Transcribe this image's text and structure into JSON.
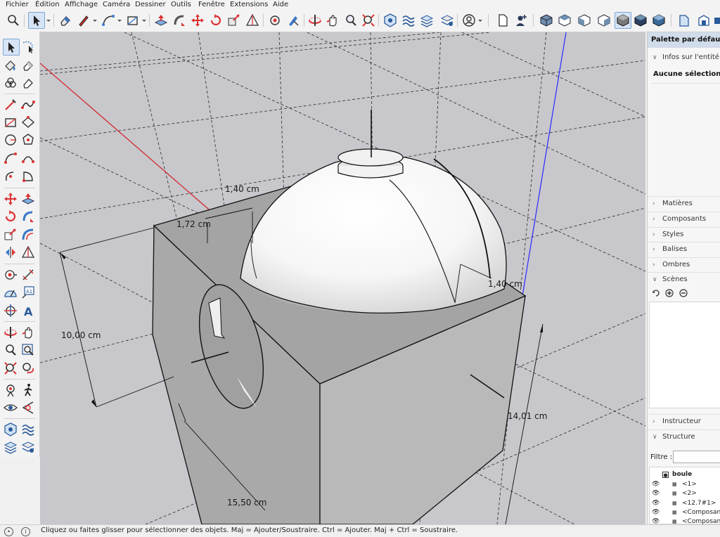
{
  "menu": [
    "Fichier",
    "Édition",
    "Affichage",
    "Caméra",
    "Dessiner",
    "Outils",
    "Fenêtre",
    "Extensions",
    "Aide"
  ],
  "toolbar_icons": [
    "search-icon",
    "select-arrow-icon",
    "eraser-icon",
    "pencil-icon",
    "arc-icon",
    "rectangle-icon",
    "push-pull-icon",
    "follow-me-icon",
    "move-icon",
    "rotate-icon",
    "scale-icon",
    "tape-measure-icon",
    "paint-bucket-icon",
    "orbit-icon",
    "pan-icon",
    "zoom-icon",
    "zoom-extents-icon",
    "solid-tools-icon",
    "sandbox-icon",
    "layers-icon",
    "account-icon",
    "document-icon",
    "user-add-icon",
    "iso-view-icon",
    "top-view-icon",
    "front-view-icon",
    "right-view-icon",
    "back-view-icon",
    "left-view-icon",
    "xray-style-icon",
    "wireframe-style-icon",
    "shaded-style-icon",
    "textured-style-icon"
  ],
  "viewport": {
    "dimensions": [
      "1,40 cm",
      "1,72 cm",
      "10,00 cm",
      "1,40 cm",
      "14,01 cm",
      "15,50 cm"
    ],
    "colors": {
      "background": "#c7c7cc",
      "red_axis": "#d32020",
      "blue_axis": "#2a2aff"
    }
  },
  "tray": {
    "title": "Palette par défaut",
    "entity_info": {
      "header": "Infos sur l'entité",
      "value": "Aucune sélection"
    },
    "sections": [
      "Matières",
      "Composants",
      "Styles",
      "Balises",
      "Ombres"
    ],
    "scenes": {
      "header": "Scènes"
    },
    "instructor": "Instructeur",
    "structure": {
      "header": "Structure",
      "filter_label": "Filtre :",
      "root": "boule",
      "items": [
        "<1>",
        "<2>",
        "<12.7#1>",
        "<Composan",
        "<Composan"
      ]
    }
  },
  "status": {
    "message": "Cliquez ou faites glisser pour sélectionner des objets. Maj = Ajouter/Soustraire. Ctrl = Ajouter. Maj + Ctrl = Soustraire."
  }
}
